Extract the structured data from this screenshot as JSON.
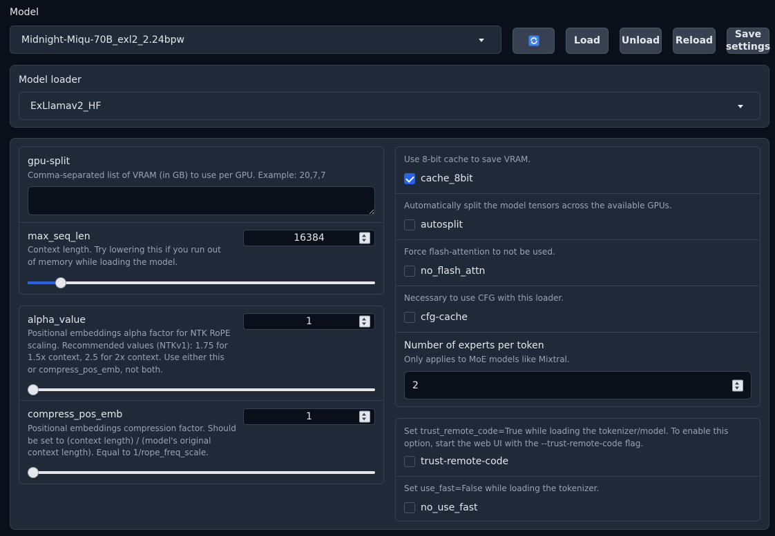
{
  "model": {
    "label": "Model",
    "selected": "Midnight-Miqu-70B_exl2_2.24bpw",
    "buttons": {
      "refresh_icon": "refresh-icon",
      "load": "Load",
      "unload": "Unload",
      "reload": "Reload",
      "save": "Save settings"
    }
  },
  "loader": {
    "label": "Model loader",
    "selected": "ExLlamav2_HF"
  },
  "gpu_split": {
    "label": "gpu-split",
    "desc": "Comma-separated list of VRAM (in GB) to use per GPU. Example: 20,7,7",
    "value": ""
  },
  "max_seq_len": {
    "label": "max_seq_len",
    "desc": "Context length. Try lowering this if you run out of memory while loading the model.",
    "value": "16384",
    "slider_fraction": 0.095
  },
  "alpha_value": {
    "label": "alpha_value",
    "desc": "Positional embeddings alpha factor for NTK RoPE scaling. Recommended values (NTKv1): 1.75 for 1.5x context, 2.5 for 2x context. Use either this or compress_pos_emb, not both.",
    "value": "1",
    "slider_fraction": 0
  },
  "compress_pos_emb": {
    "label": "compress_pos_emb",
    "desc": "Positional embeddings compression factor. Should be set to (context length) / (model's original context length). Equal to 1/rope_freq_scale.",
    "value": "1",
    "slider_fraction": 0
  },
  "options": [
    {
      "desc": "Use 8-bit cache to save VRAM.",
      "label": "cache_8bit",
      "checked": true
    },
    {
      "desc": "Automatically split the model tensors across the available GPUs.",
      "label": "autosplit",
      "checked": false
    },
    {
      "desc": "Force flash-attention to not be used.",
      "label": "no_flash_attn",
      "checked": false
    },
    {
      "desc": "Necessary to use CFG with this loader.",
      "label": "cfg-cache",
      "checked": false
    }
  ],
  "experts": {
    "label": "Number of experts per token",
    "desc": "Only applies to MoE models like Mixtral.",
    "value": "2"
  },
  "trust": {
    "desc": "Set trust_remote_code=True while loading the tokenizer/model. To enable this option, start the web UI with the --trust-remote-code flag.",
    "label": "trust-remote-code",
    "checked": false
  },
  "use_fast": {
    "desc": "Set use_fast=False while loading the tokenizer.",
    "label": "no_use_fast",
    "checked": false
  },
  "colors": {
    "accent": "#2563eb",
    "background": "#0b0f19",
    "panel": "#1f2937",
    "border": "#374151"
  }
}
